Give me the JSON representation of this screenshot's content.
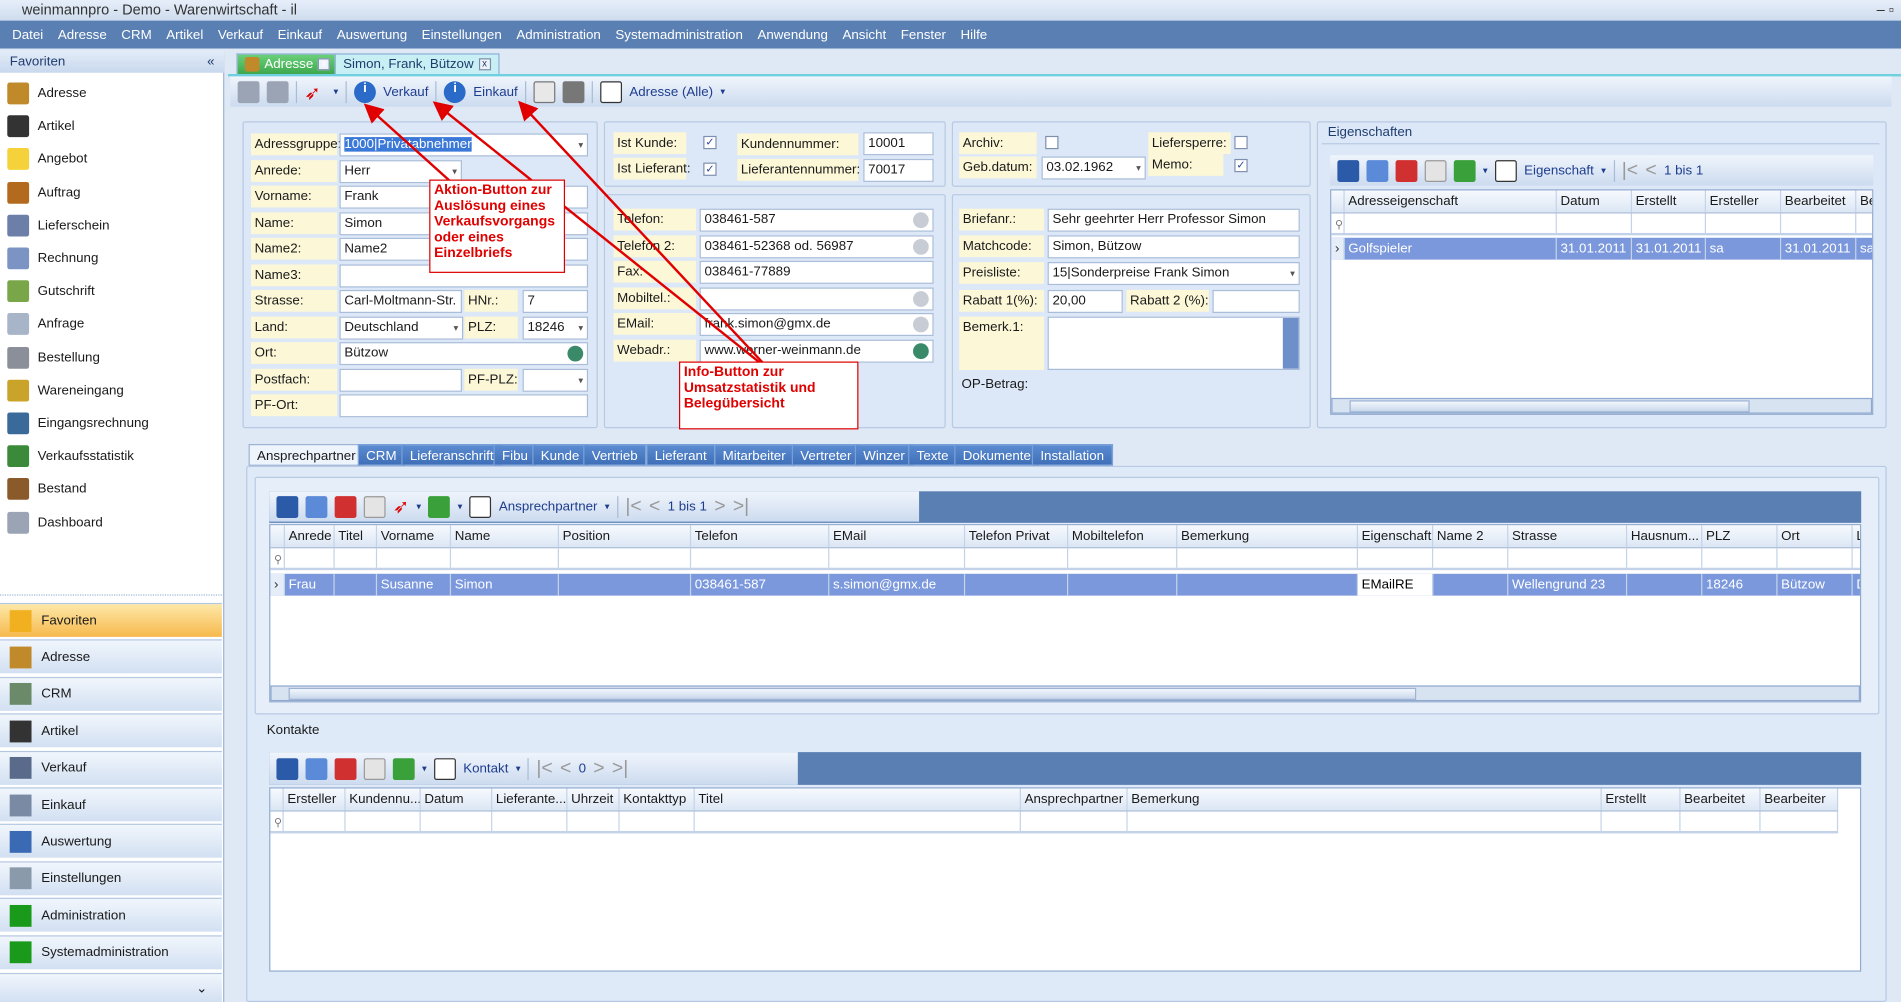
{
  "window": {
    "title": "weinmannpro - Demo - Warenwirtschaft - il"
  },
  "menu": [
    "Datei",
    "Adresse",
    "CRM",
    "Artikel",
    "Verkauf",
    "Einkauf",
    "Auswertung",
    "Einstellungen",
    "Administration",
    "Systemadministration",
    "Anwendung",
    "Ansicht",
    "Fenster",
    "Hilfe"
  ],
  "sidebar": {
    "header": "Favoriten",
    "collapse": "«",
    "items": [
      {
        "label": "Adresse",
        "color": "#c08a2a"
      },
      {
        "label": "Artikel",
        "color": "#333"
      },
      {
        "label": "Angebot",
        "color": "#f5d23a"
      },
      {
        "label": "Auftrag",
        "color": "#b46a1e"
      },
      {
        "label": "Lieferschein",
        "color": "#6b7fa8"
      },
      {
        "label": "Rechnung",
        "color": "#7b94c4"
      },
      {
        "label": "Gutschrift",
        "color": "#7aa64a"
      },
      {
        "label": "Anfrage",
        "color": "#a8b4c8"
      },
      {
        "label": "Bestellung",
        "color": "#8a8f99"
      },
      {
        "label": "Wareneingang",
        "color": "#c9a32a"
      },
      {
        "label": "Eingangsrechnung",
        "color": "#3a6a9a"
      },
      {
        "label": "Verkaufsstatistik",
        "color": "#3a8a3a"
      },
      {
        "label": "Bestand",
        "color": "#8a5a2a"
      },
      {
        "label": "Dashboard",
        "color": "#9aa4b4"
      }
    ],
    "groups": [
      {
        "label": "Favoriten",
        "color": "#f0b020"
      },
      {
        "label": "Adresse",
        "color": "#c08a2a"
      },
      {
        "label": "CRM",
        "color": "#6a8a6a"
      },
      {
        "label": "Artikel",
        "color": "#333"
      },
      {
        "label": "Verkauf",
        "color": "#5a6a8a"
      },
      {
        "label": "Einkauf",
        "color": "#7a8aa4"
      },
      {
        "label": "Auswertung",
        "color": "#3a6ab4"
      },
      {
        "label": "Einstellungen",
        "color": "#8a9aaa"
      },
      {
        "label": "Administration",
        "color": "#1a9a1a"
      },
      {
        "label": "Systemadministration",
        "color": "#1a9a1a"
      }
    ],
    "more": "⌄"
  },
  "doc_tabs": [
    {
      "label": "Adresse"
    },
    {
      "label": "Simon, Frank, Bützow"
    }
  ],
  "toolbar": {
    "verkauf": "Verkauf",
    "einkauf": "Einkauf",
    "view": "Adresse (Alle)"
  },
  "form": {
    "adressgruppe": {
      "label": "Adressgruppe:",
      "value": "1000|Privatabnehmer"
    },
    "anrede": {
      "label": "Anrede:",
      "value": "Herr"
    },
    "vorname": {
      "label": "Vorname:",
      "value": "Frank"
    },
    "name": {
      "label": "Name:",
      "value": "Simon"
    },
    "name2": {
      "label": "Name2:",
      "value": "Name2"
    },
    "name3": {
      "label": "Name3:",
      "value": ""
    },
    "strasse": {
      "label": "Strasse:",
      "value": "Carl-Moltmann-Str."
    },
    "hnr": {
      "label": "HNr.:",
      "value": "7"
    },
    "land": {
      "label": "Land:",
      "value": "Deutschland"
    },
    "plz": {
      "label": "PLZ:",
      "value": "18246"
    },
    "ort": {
      "label": "Ort:",
      "value": "Bützow"
    },
    "postfach": {
      "label": "Postfach:",
      "value": ""
    },
    "pfplz": {
      "label": "PF-PLZ:",
      "value": ""
    },
    "pfort": {
      "label": "PF-Ort:",
      "value": ""
    },
    "ist_kunde": {
      "label": "Ist Kunde:",
      "checked": true
    },
    "ist_lieferant": {
      "label": "Ist Lieferant:",
      "checked": true
    },
    "kundennummer": {
      "label": "Kundennummer:",
      "value": "10001"
    },
    "lieferantennummer": {
      "label": "Lieferantennummer:",
      "value": "70017"
    },
    "telefon": {
      "label": "Telefon:",
      "value": "038461-587"
    },
    "telefon2": {
      "label": "Telefon 2:",
      "value": "038461-52368 od. 56987"
    },
    "fax": {
      "label": "Fax:",
      "value": "038461-77889"
    },
    "mobiltel": {
      "label": "Mobiltel.:",
      "value": ""
    },
    "email": {
      "label": "EMail:",
      "value": "frank.simon@gmx.de"
    },
    "webadr": {
      "label": "Webadr.:",
      "value": "www.werner-weinmann.de"
    },
    "archiv": {
      "label": "Archiv:",
      "checked": false
    },
    "liefersperre": {
      "label": "Liefersperre:",
      "checked": false
    },
    "gebdatum": {
      "label": "Geb.datum:",
      "value": "03.02.1962"
    },
    "memo": {
      "label": "Memo:",
      "checked": true
    },
    "briefanr": {
      "label": "Briefanr.:",
      "value": "Sehr geehrter Herr Professor Simon"
    },
    "matchcode": {
      "label": "Matchcode:",
      "value": "Simon, Bützow"
    },
    "preisliste": {
      "label": "Preisliste:",
      "value": "15|Sonderpreise Frank Simon"
    },
    "rabatt1": {
      "label": "Rabatt 1(%):",
      "value": "20,00"
    },
    "rabatt2": {
      "label": "Rabatt 2 (%):",
      "value": ""
    },
    "bemerk1": {
      "label": "Bemerk.1:",
      "value": ""
    },
    "opbetrag": {
      "label": "OP-Betrag:"
    }
  },
  "eigenschaften": {
    "title": "Eigenschaften",
    "view": "Eigenschaft",
    "pager": "1 bis 1",
    "columns": [
      "Adresseigenschaft",
      "Datum",
      "Erstellt",
      "Ersteller",
      "Bearbeitet",
      "Be"
    ],
    "rows": [
      [
        "Golfspieler",
        "31.01.2011",
        "31.01.2011",
        "sa",
        "31.01.2011",
        "sa"
      ]
    ]
  },
  "subtabs": [
    "Ansprechpartner",
    "CRM",
    "Lieferanschrift",
    "Fibu",
    "Kunde",
    "Vertrieb",
    "Lieferant",
    "Mitarbeiter",
    "Vertreter",
    "Winzer",
    "Texte",
    "Dokumente",
    "Installation"
  ],
  "ansprechpartner": {
    "view": "Ansprechpartner",
    "pager": "1 bis 1",
    "columns": [
      "Anrede",
      "Titel",
      "Vorname",
      "Name",
      "Position",
      "Telefon",
      "EMail",
      "Telefon Privat",
      "Mobiltelefon",
      "Bemerkung",
      "Eigenschaft",
      "Name 2",
      "Strasse",
      "Hausnum...",
      "PLZ",
      "Ort",
      "L"
    ],
    "rows": [
      [
        "Frau",
        "",
        "Susanne",
        "Simon",
        "",
        "038461-587",
        "s.simon@gmx.de",
        "",
        "",
        "",
        "EMailRE",
        "",
        "Wellengrund 23",
        "",
        "18246",
        "Bützow",
        "D"
      ]
    ]
  },
  "kontakte": {
    "title": "Kontakte",
    "view": "Kontakt",
    "pager": "0",
    "columns": [
      "Ersteller",
      "Kundennu...",
      "Datum",
      "Lieferante...",
      "Uhrzeit",
      "Kontakttyp",
      "Titel",
      "Ansprechpartner",
      "Bemerkung",
      "Erstellt",
      "Bearbeitet",
      "Bearbeiter"
    ],
    "rows": []
  },
  "annotations": {
    "aktion": "Aktion-Button zur Auslösung eines Verkaufsvorgangs oder eines Einzelbriefs",
    "info": "Info-Button zur Umsatzstatistik und Belegübersicht",
    "color": "#e00000"
  }
}
